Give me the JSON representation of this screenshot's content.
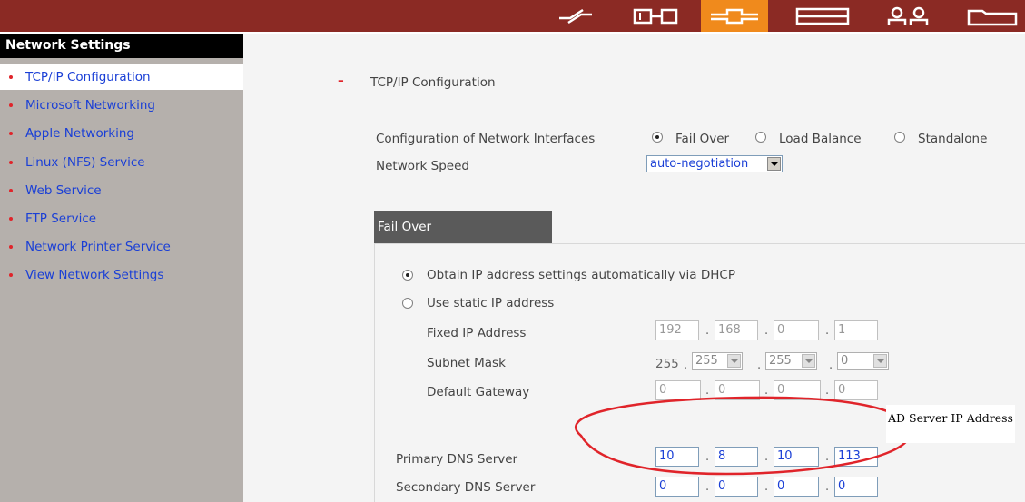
{
  "toolbar": {
    "icons": [
      "network-icon",
      "server-icon",
      "system-icon",
      "storage-icon",
      "users-icon",
      "folder-icon"
    ],
    "active": "system-icon",
    "accent": "#f08a1c",
    "bar_color": "#8b2a24"
  },
  "sidebar": {
    "title": "Network Settings",
    "items": [
      {
        "label": "TCP/IP Configuration",
        "active": true
      },
      {
        "label": "Microsoft Networking"
      },
      {
        "label": "Apple Networking"
      },
      {
        "label": "Linux (NFS) Service"
      },
      {
        "label": "Web Service"
      },
      {
        "label": "FTP Service"
      },
      {
        "label": "Network Printer Service"
      },
      {
        "label": "View Network Settings"
      }
    ]
  },
  "main": {
    "collapse_symbol": "–",
    "section_title": "TCP/IP Configuration",
    "config_label": "Configuration of Network Interfaces",
    "modes": [
      "Fail Over",
      "Load Balance",
      "Standalone"
    ],
    "selected_mode": "Fail Over",
    "speed_label": "Network Speed",
    "speed_value": "auto-negotiation",
    "tab_label": "Fail Over",
    "dhcp_label": "Obtain IP address settings automatically via DHCP",
    "static_label": "Use static IP address",
    "fixed_ip_label": "Fixed IP Address",
    "fixed_ip": [
      "192",
      "168",
      "0",
      "1"
    ],
    "subnet_label": "Subnet Mask",
    "subnet": [
      "255",
      "255",
      "255",
      "0"
    ],
    "gateway_label": "Default Gateway",
    "gateway": [
      "0",
      "0",
      "0",
      "0"
    ],
    "primary_dns_label": "Primary DNS Server",
    "primary_dns": [
      "10",
      "8",
      "10",
      "113"
    ],
    "secondary_dns_label": "Secondary DNS Server",
    "secondary_dns": [
      "0",
      "0",
      "0",
      "0"
    ],
    "ip_separator": "."
  },
  "annotation": {
    "text": "AD Server IP Address",
    "color": "#e0242a"
  }
}
